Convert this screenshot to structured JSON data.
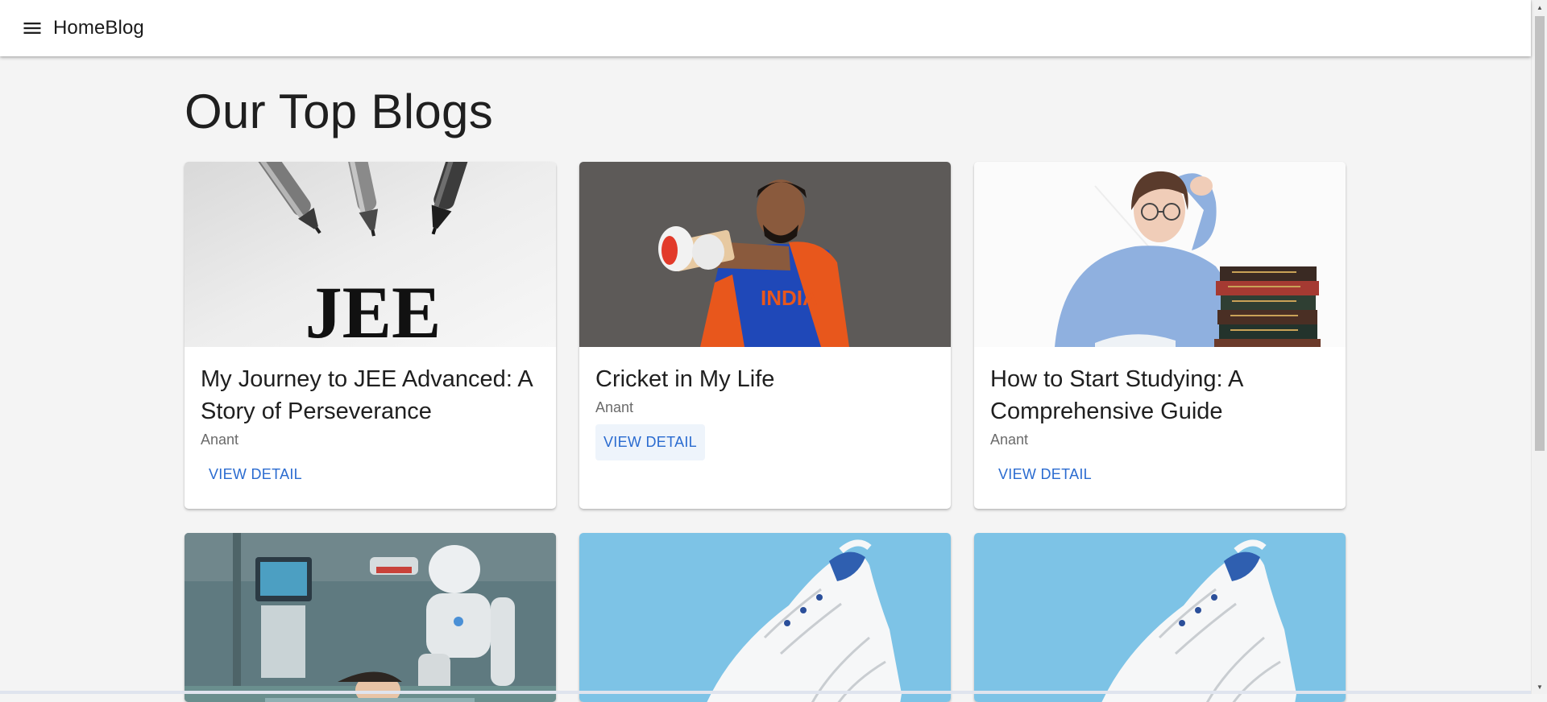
{
  "appbar": {
    "menu_icon": "menu-icon",
    "brand": "HomeBlog"
  },
  "main": {
    "title": "Our Top Blogs"
  },
  "cards": [
    {
      "image": "pens-jee-image",
      "image_text": "JEE",
      "title": "My Journey to JEE Advanced: A Story of Perseverance",
      "author": "Anant",
      "action": "VIEW DETAIL"
    },
    {
      "image": "cricketer-image",
      "image_text": "INDIA",
      "title": "Cricket in My Life",
      "author": "Anant",
      "action": "VIEW DETAIL"
    },
    {
      "image": "student-books-image",
      "title": "How to Start Studying: A Comprehensive Guide",
      "author": "Anant",
      "action": "VIEW DETAIL"
    },
    {
      "image": "robot-hospital-image"
    },
    {
      "image": "white-sneaker-image"
    },
    {
      "image": "white-sneaker-image"
    }
  ],
  "colors": {
    "background": "#f4f4f4",
    "card": "#ffffff",
    "accent": "#2a6bd0",
    "author_text": "#6b6b6b",
    "sneaker_bg": "#7dc3e6"
  }
}
